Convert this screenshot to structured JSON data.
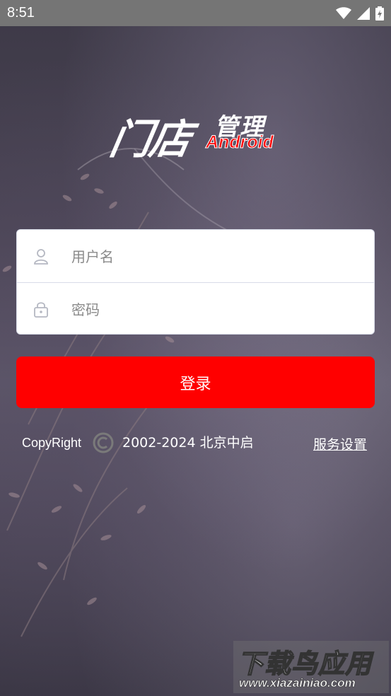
{
  "status_bar": {
    "time": "8:51"
  },
  "logo": {
    "main": "门店",
    "sub": "管理",
    "android": "Android"
  },
  "login_form": {
    "username_placeholder": "用户名",
    "password_placeholder": "密码",
    "login_label": "登录"
  },
  "footer": {
    "copyright_label": "CopyRight",
    "copyright_text": "2002-2024 北京中启",
    "service_settings": "服务设置"
  },
  "watermark": {
    "title": "下载鸟应用",
    "url": "www.xiazainiao.com"
  },
  "colors": {
    "accent": "#ff0000",
    "status_bar": "#757575",
    "card_background": "#ffffff"
  },
  "icons": {
    "wifi": "wifi-icon",
    "signal": "signal-icon",
    "battery": "battery-charging-icon",
    "user": "user-icon",
    "lock": "lock-icon",
    "copyright": "copyright-icon"
  }
}
